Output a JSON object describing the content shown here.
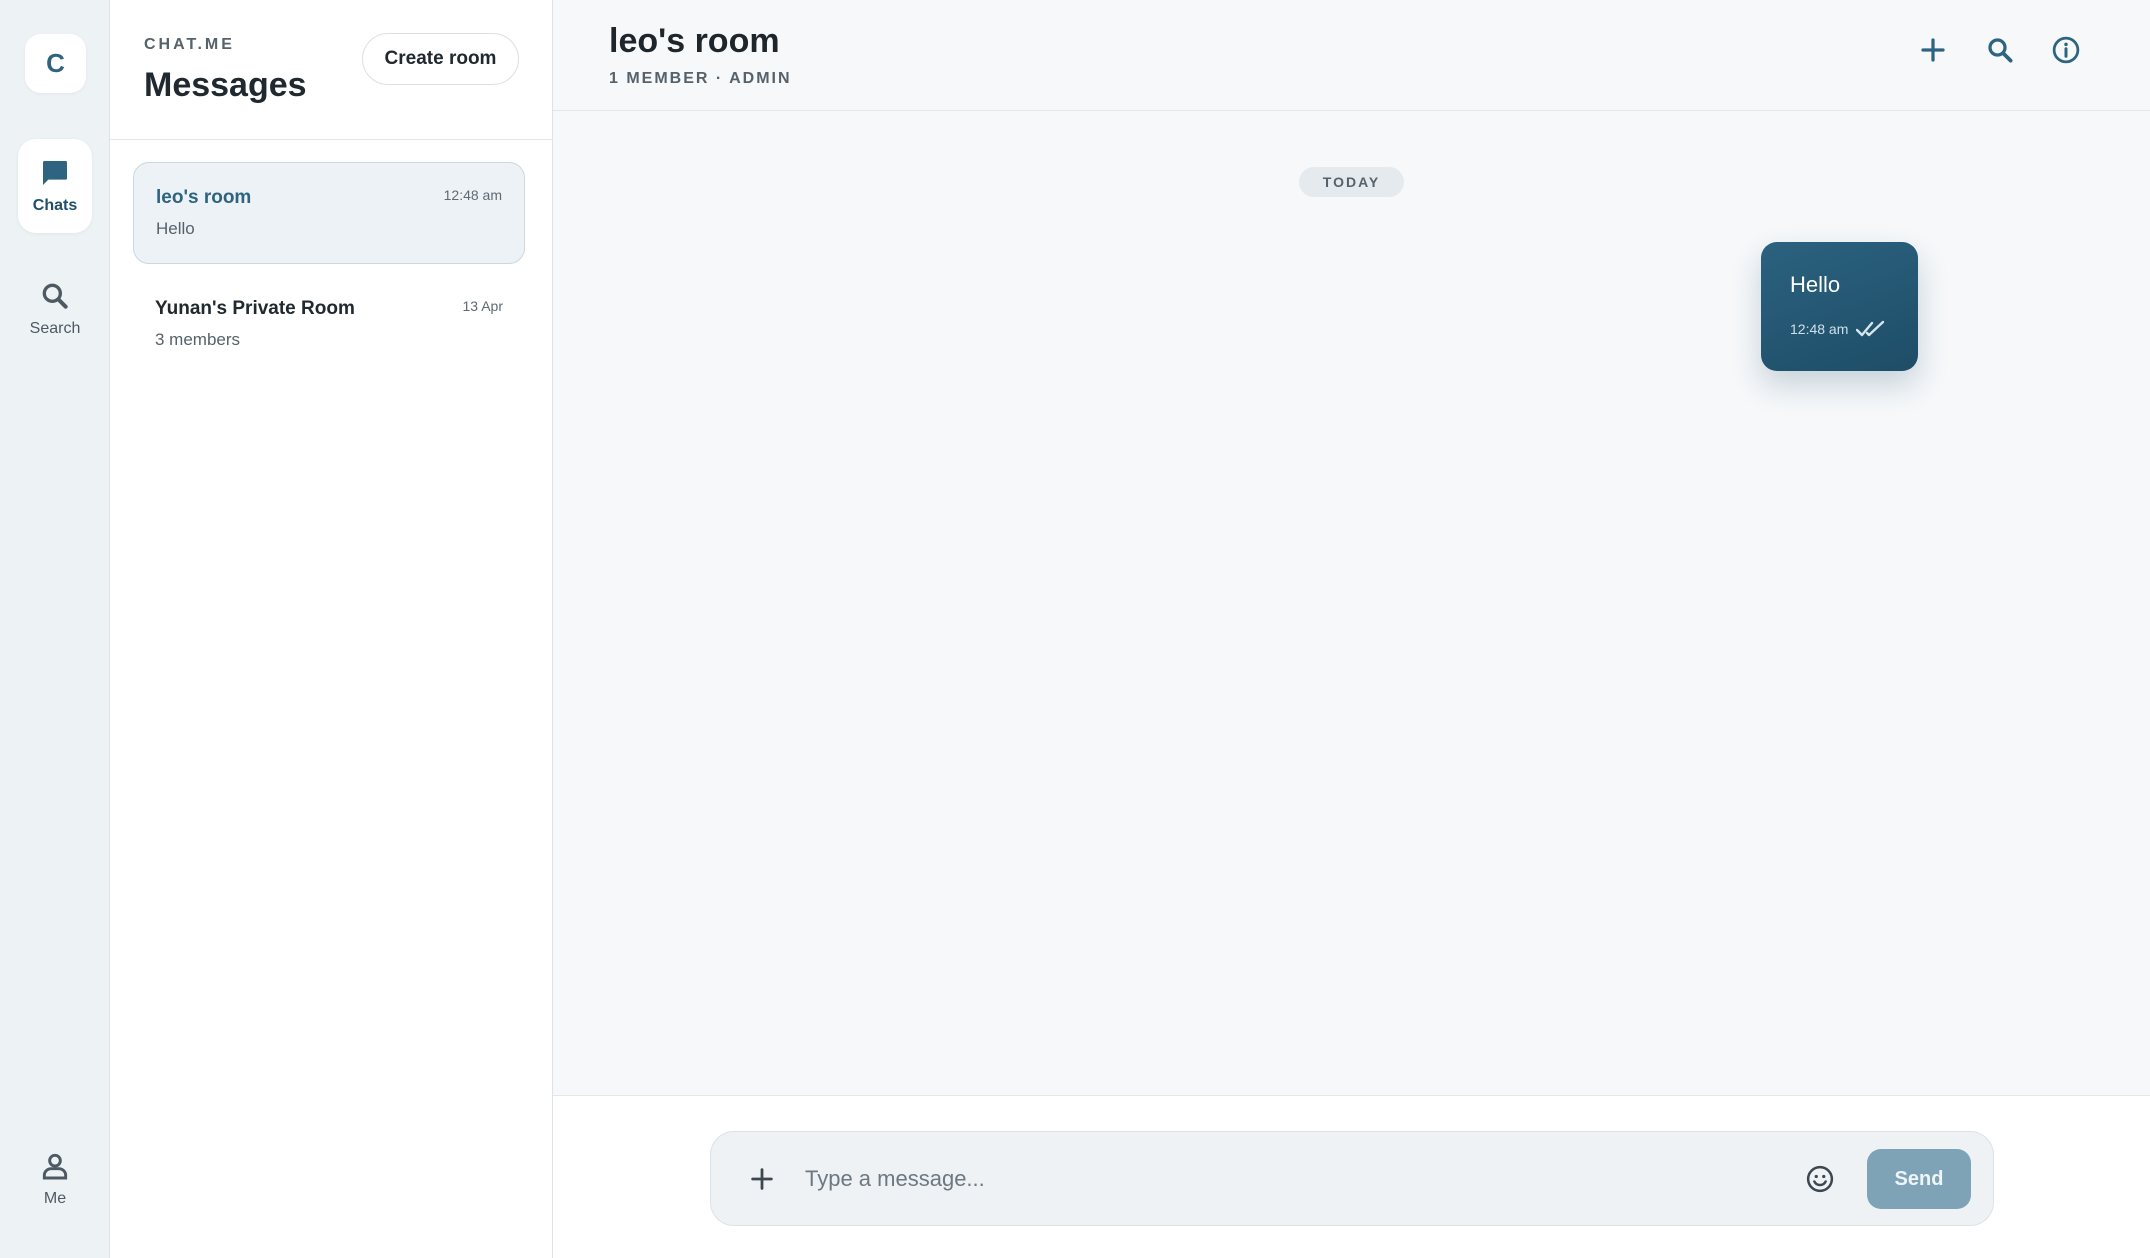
{
  "app": {
    "logo_letter": "C",
    "brand": "CHAT.ME",
    "accent_color": "#2f6480"
  },
  "rail": {
    "items": [
      {
        "label": "Chats",
        "icon": "chat-bubble-icon",
        "active": true
      },
      {
        "label": "Search",
        "icon": "search-icon",
        "active": false
      }
    ],
    "profile": {
      "label": "Me",
      "icon": "person-icon"
    }
  },
  "panel": {
    "title": "Messages",
    "create_label": "Create room",
    "rooms": [
      {
        "name": "leo's room",
        "preview": "Hello",
        "time": "12:48 am",
        "active": true
      },
      {
        "name": "Yunan's Private Room",
        "preview": "3 members",
        "time": "13 Apr",
        "active": false
      }
    ]
  },
  "chat": {
    "title": "leo's room",
    "subtitle": "1 MEMBER · ADMIN",
    "actions": [
      "plus-icon",
      "search-icon",
      "info-icon"
    ],
    "day_label": "TODAY",
    "messages": [
      {
        "text": "Hello",
        "time": "12:48 am",
        "status": "read",
        "outgoing": true
      }
    ]
  },
  "composer": {
    "placeholder": "Type a message...",
    "value": "",
    "send_label": "Send"
  }
}
